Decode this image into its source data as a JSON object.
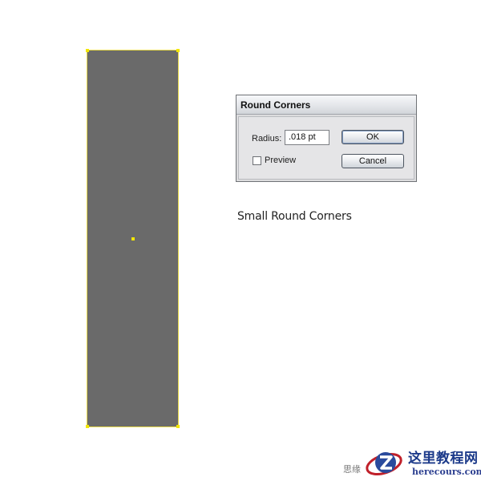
{
  "dialog": {
    "title": "Round Corners",
    "radius_label": "Radius:",
    "radius_value": ".018 pt",
    "preview_label": "Preview",
    "preview_checked": false,
    "ok_label": "OK",
    "cancel_label": "Cancel"
  },
  "caption": "Small Round Corners",
  "watermark": {
    "small_text": "思缘",
    "title": "这里教程网",
    "url": "herecours.com",
    "logo_icon": "z-swirl-logo-icon"
  },
  "colors": {
    "artwork_fill": "#6a6a6a",
    "selection": "#f2e600",
    "dialog_bg": "#dcdcde"
  }
}
